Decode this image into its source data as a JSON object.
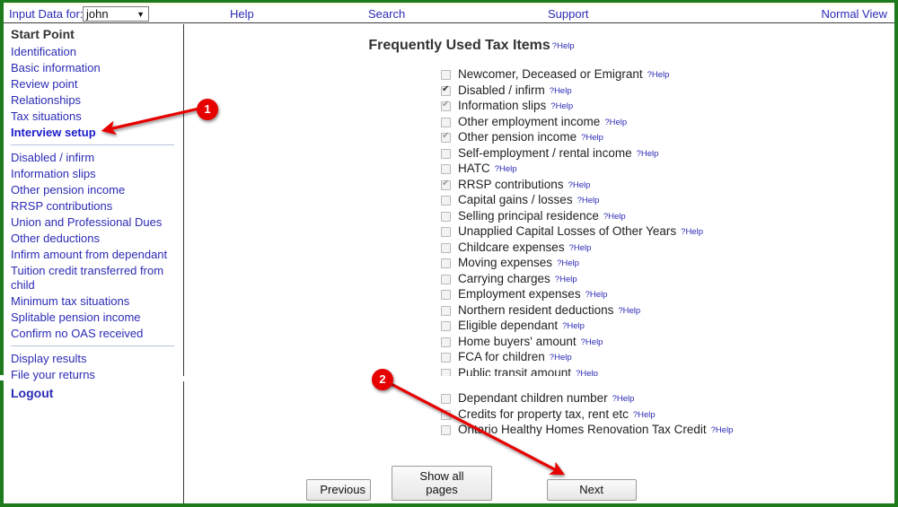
{
  "topbar": {
    "input_data_label": "Input Data for:",
    "user_value": "john",
    "caret_icon": "chevron-down-icon",
    "links": {
      "help": "Help",
      "search": "Search",
      "support": "Support",
      "normal_view": "Normal View"
    }
  },
  "sidebar": {
    "heading": "Start Point",
    "group1": [
      {
        "label": "Identification"
      },
      {
        "label": "Basic information"
      },
      {
        "label": "Review point"
      },
      {
        "label": "Relationships"
      },
      {
        "label": "Tax situations"
      },
      {
        "label": "Interview setup",
        "current": true
      }
    ],
    "group2": [
      {
        "label": "Disabled / infirm"
      },
      {
        "label": "Information slips"
      },
      {
        "label": "Other pension income"
      },
      {
        "label": "RRSP contributions"
      },
      {
        "label": "Union and Professional Dues"
      },
      {
        "label": "Other deductions"
      },
      {
        "label": "Infirm amount from dependant"
      },
      {
        "label": "Tuition credit transferred from child"
      },
      {
        "label": "Minimum tax situations"
      },
      {
        "label": "Splitable pension income"
      },
      {
        "label": "Confirm no OAS received"
      }
    ],
    "group3": [
      {
        "label": "Display results"
      },
      {
        "label": "File your returns"
      },
      {
        "label": "Logout",
        "bold": true
      }
    ]
  },
  "main": {
    "title": "Frequently Used Tax Items",
    "title_help": "?Help",
    "help_label": "?Help",
    "items_top": [
      {
        "label": "Newcomer, Deceased or Emigrant",
        "state": "unchecked"
      },
      {
        "label": "Disabled / infirm",
        "state": "checked"
      },
      {
        "label": "Information slips",
        "state": "checked-dim"
      },
      {
        "label": "Other employment income",
        "state": "unchecked"
      },
      {
        "label": "Other pension income",
        "state": "checked-dim"
      },
      {
        "label": "Self-employment / rental income",
        "state": "unchecked"
      },
      {
        "label": "HATC",
        "state": "unchecked"
      },
      {
        "label": "RRSP contributions",
        "state": "checked-dim"
      },
      {
        "label": "Capital gains / losses",
        "state": "unchecked"
      },
      {
        "label": "Selling principal residence",
        "state": "unchecked"
      },
      {
        "label": "Unapplied Capital Losses of Other Years",
        "state": "unchecked"
      },
      {
        "label": "Childcare expenses",
        "state": "unchecked"
      },
      {
        "label": "Moving expenses",
        "state": "unchecked"
      },
      {
        "label": "Carrying charges",
        "state": "unchecked"
      },
      {
        "label": "Employment expenses",
        "state": "unchecked"
      },
      {
        "label": "Northern resident deductions",
        "state": "unchecked"
      },
      {
        "label": "Eligible dependant",
        "state": "unchecked"
      },
      {
        "label": "Home buyers' amount",
        "state": "unchecked"
      },
      {
        "label": "FCA for children",
        "state": "unchecked"
      },
      {
        "label": "Public transit amount",
        "state": "unchecked"
      }
    ],
    "items_bottom": [
      {
        "label": "Dependant children number",
        "state": "unchecked"
      },
      {
        "label": "Credits for property tax, rent etc",
        "state": "unchecked"
      },
      {
        "label": "Ontario Healthy Homes Renovation Tax Credit",
        "state": "unchecked"
      }
    ],
    "buttons": {
      "previous": "Previous",
      "show_all_pages": "Show all pages",
      "next": "Next"
    }
  },
  "annotations": {
    "badge1": "1",
    "badge2": "2",
    "accent_color": "#e60000"
  }
}
